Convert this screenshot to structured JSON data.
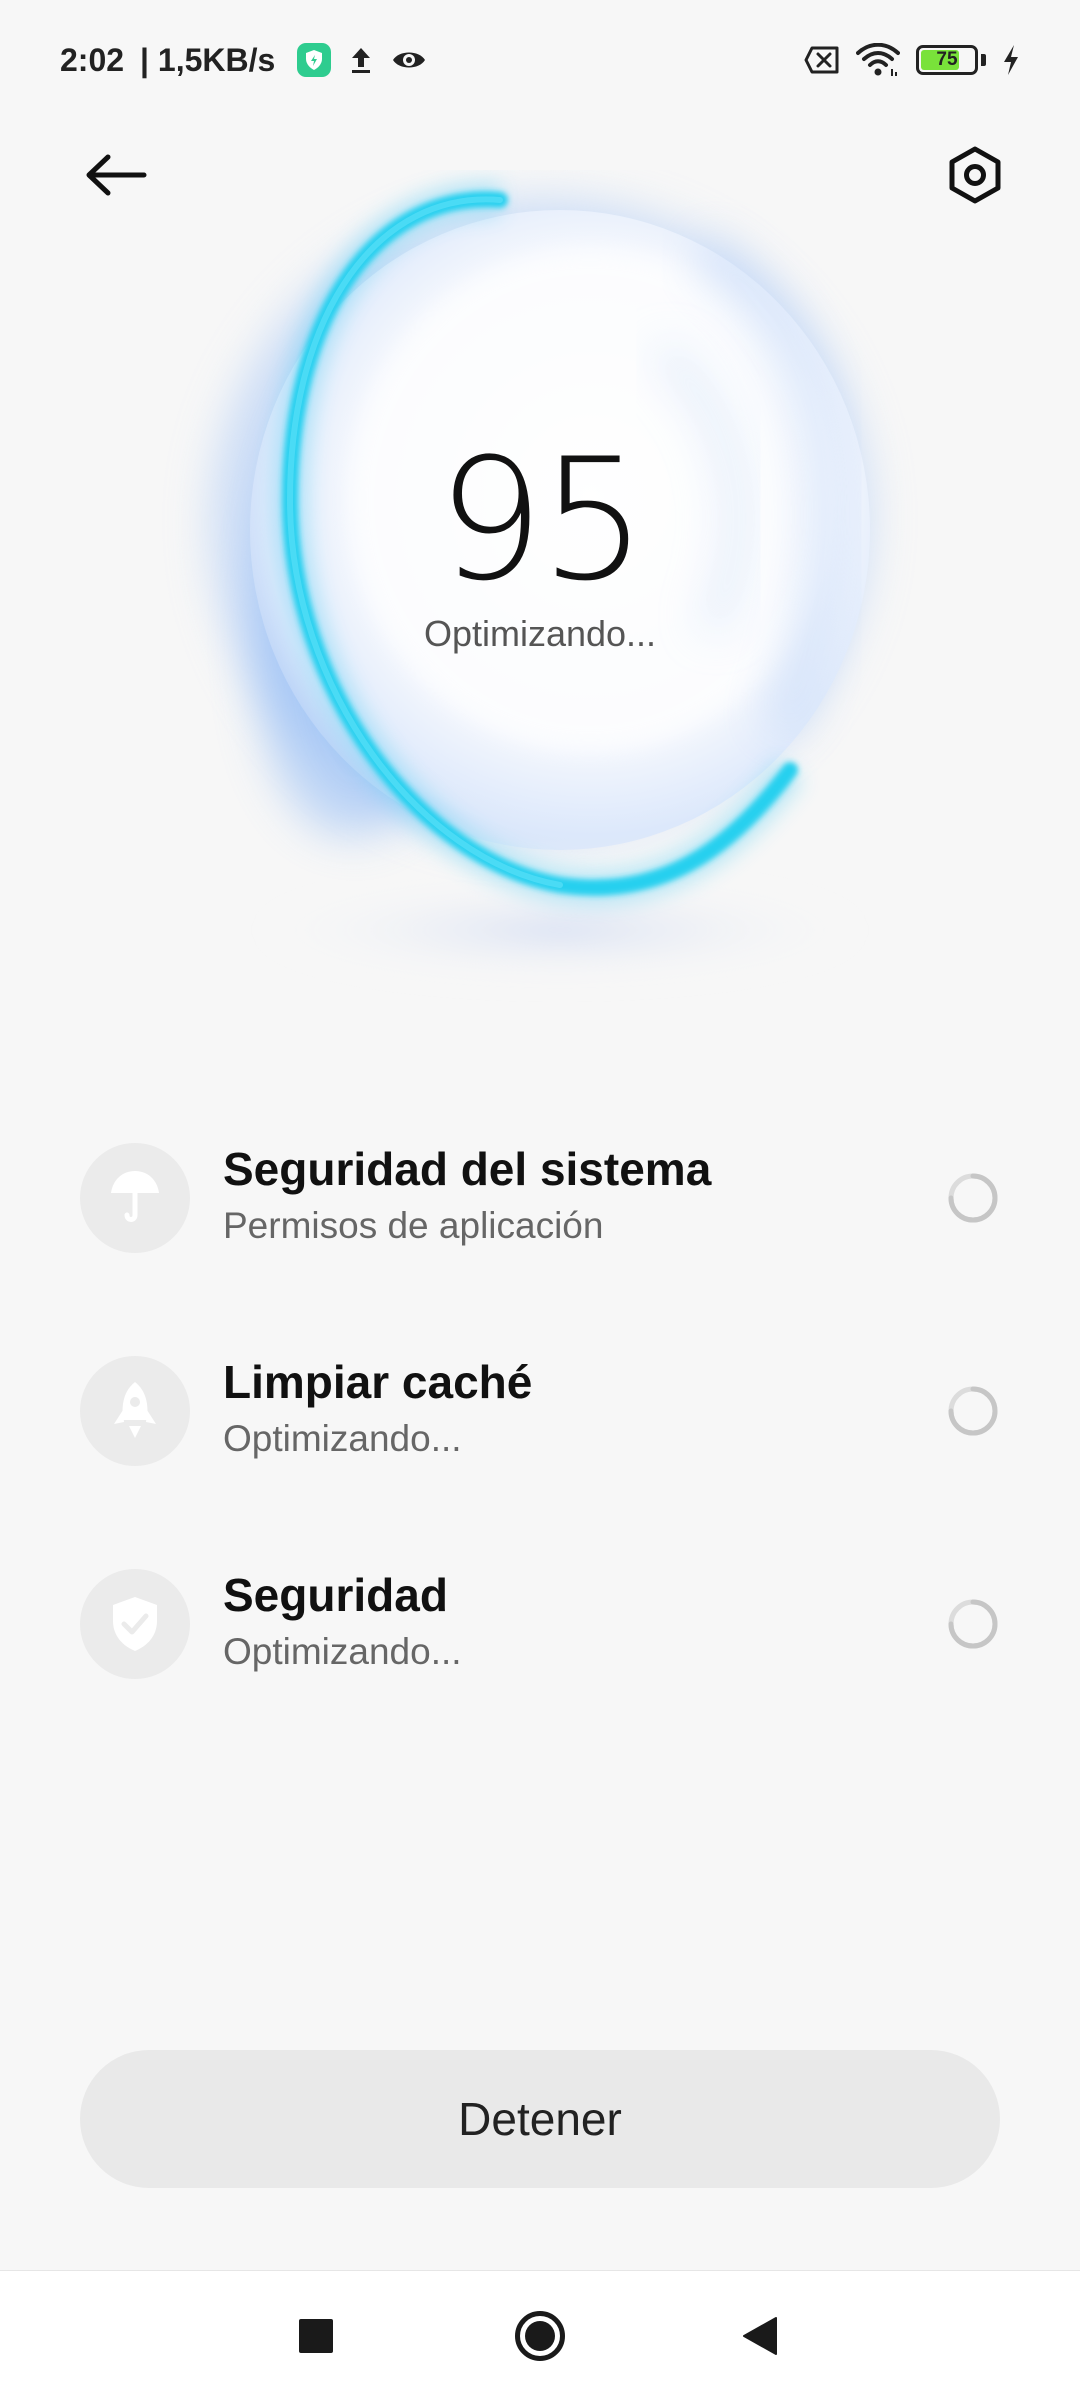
{
  "status_bar": {
    "time": "2:02",
    "network_speed": "| 1,5KB/s",
    "battery_level": "75",
    "battery_fraction": 0.75,
    "icons": [
      "shield-app-icon",
      "upload-icon",
      "eye-icon",
      "sim-off-icon",
      "wifi-icon",
      "battery-icon",
      "charging-bolt-icon"
    ]
  },
  "header": {
    "back_icon": "arrow-left-icon",
    "settings_icon": "hexagon-settings-icon"
  },
  "orb": {
    "score": "95",
    "status": "Optimizando..."
  },
  "tasks": [
    {
      "title": "Seguridad del sistema",
      "subtitle": "Permisos de aplicación",
      "icon": "umbrella-icon",
      "state": "loading-spinner-icon"
    },
    {
      "title": "Limpiar caché",
      "subtitle": "Optimizando...",
      "icon": "rocket-icon",
      "state": "loading-spinner-icon"
    },
    {
      "title": "Seguridad",
      "subtitle": "Optimizando...",
      "icon": "shield-check-icon",
      "state": "loading-spinner-icon"
    }
  ],
  "stop_button": {
    "label": "Detener"
  },
  "navigation": {
    "icons": [
      "recents-square-icon",
      "home-circle-icon",
      "back-triangle-icon"
    ]
  },
  "colors": {
    "orb_ring": "#25d0ef",
    "orb_glow": "#7eb6f5",
    "background": "#f7f7f7",
    "battery_fill": "#79e23a"
  }
}
